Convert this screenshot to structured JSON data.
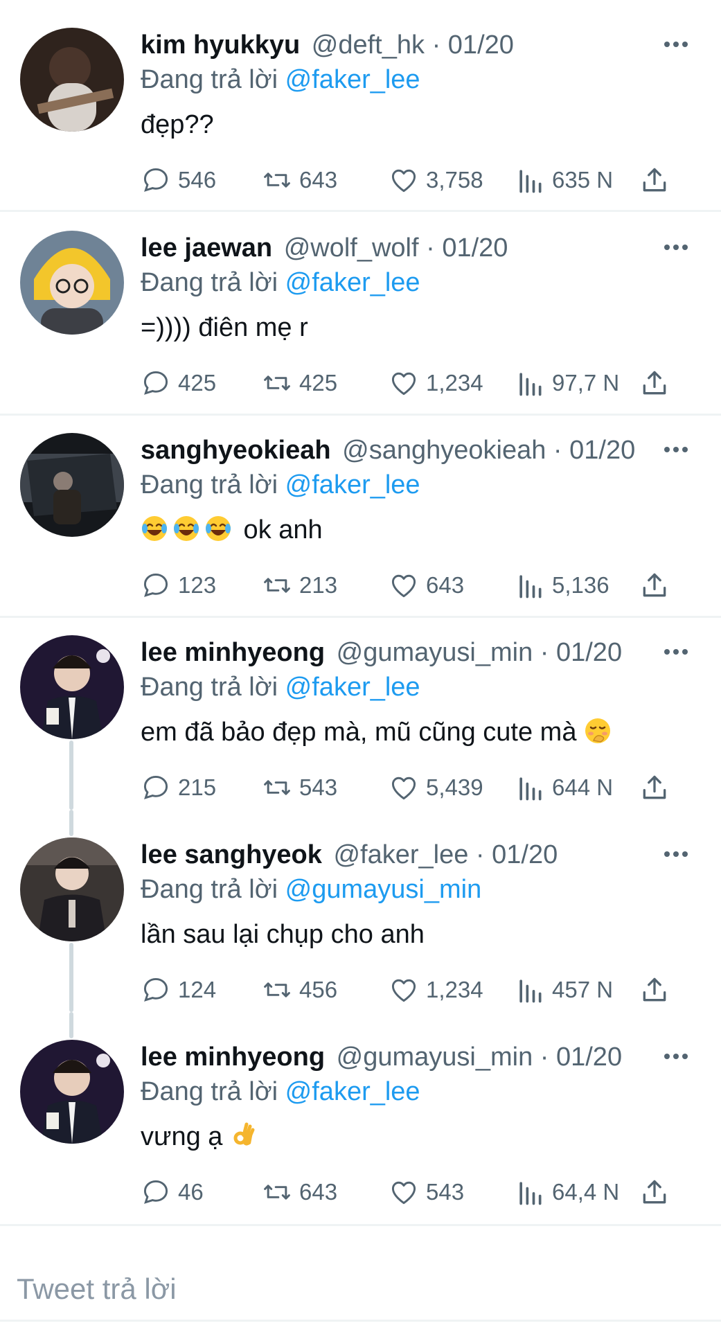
{
  "tweets": [
    {
      "name": "kim hyukkyu",
      "handle": "@deft_hk",
      "date": "01/20",
      "replying_prefix": "Đang trả lời",
      "replying_to": "@faker_lee",
      "text": "đẹp??",
      "emojis": [],
      "replies": "546",
      "retweets": "643",
      "likes": "3,758",
      "views": "635 N",
      "avatar_colors": [
        "#3a2a22",
        "#a99080"
      ]
    },
    {
      "name": "lee jaewan",
      "handle": "@wolf_wolf",
      "date": "01/20",
      "replying_prefix": "Đang trả lời",
      "replying_to": "@faker_lee",
      "text": "=)))) điên mẹ r",
      "emojis": [],
      "replies": "425",
      "retweets": "425",
      "likes": "1,234",
      "views": "97,7 N",
      "avatar_colors": [
        "#5b6f86",
        "#f2c230"
      ]
    },
    {
      "name": "sanghyeokieah",
      "handle": "@sanghyeokieah",
      "date": "01/20",
      "replying_prefix": "Đang trả lời",
      "replying_to": "@faker_lee",
      "text": " ok anh",
      "emojis": [
        "laughing-crying",
        "laughing-crying",
        "laughing-crying"
      ],
      "replies": "123",
      "retweets": "213",
      "likes": "643",
      "views": "5,136",
      "avatar_colors": [
        "#1c1f24",
        "#6d7580"
      ]
    },
    {
      "name": "lee minhyeong",
      "handle": "@gumayusi_min",
      "date": "01/20",
      "replying_prefix": "Đang trả lời",
      "replying_to": "@faker_lee",
      "text": "em đã bảo đẹp mà, mũ cũng cute mà ",
      "emojis_after": [
        "shy-face"
      ],
      "replies": "215",
      "retweets": "543",
      "likes": "5,439",
      "views": "644 N",
      "avatar_colors": [
        "#2a1d3c",
        "#c9b6a5"
      ]
    },
    {
      "name": "lee sanghyeok",
      "handle": "@faker_lee",
      "date": "01/20",
      "replying_prefix": "Đang trả lời",
      "replying_to": "@gumayusi_min",
      "text": "lần sau lại chụp cho anh",
      "emojis": [],
      "replies": "124",
      "retweets": "456",
      "likes": "1,234",
      "views": "457 N",
      "avatar_colors": [
        "#2d2a2a",
        "#b7aaa0"
      ]
    },
    {
      "name": "lee minhyeong",
      "handle": "@gumayusi_min",
      "date": "01/20",
      "replying_prefix": "Đang trả lời",
      "replying_to": "@faker_lee",
      "text": "vưng ạ ",
      "emojis_after": [
        "ok-hand"
      ],
      "replies": "46",
      "retweets": "643",
      "likes": "543",
      "views": "64,4 N",
      "avatar_colors": [
        "#2a1d3c",
        "#c9b6a5"
      ]
    }
  ],
  "compose": {
    "placeholder": "Tweet trả lời"
  },
  "colors": {
    "link": "#1d9bf0",
    "muted": "#536471",
    "divider": "#eff3f4"
  },
  "icons": [
    "reply-icon",
    "retweet-icon",
    "like-icon",
    "views-icon",
    "share-icon",
    "more-icon"
  ]
}
